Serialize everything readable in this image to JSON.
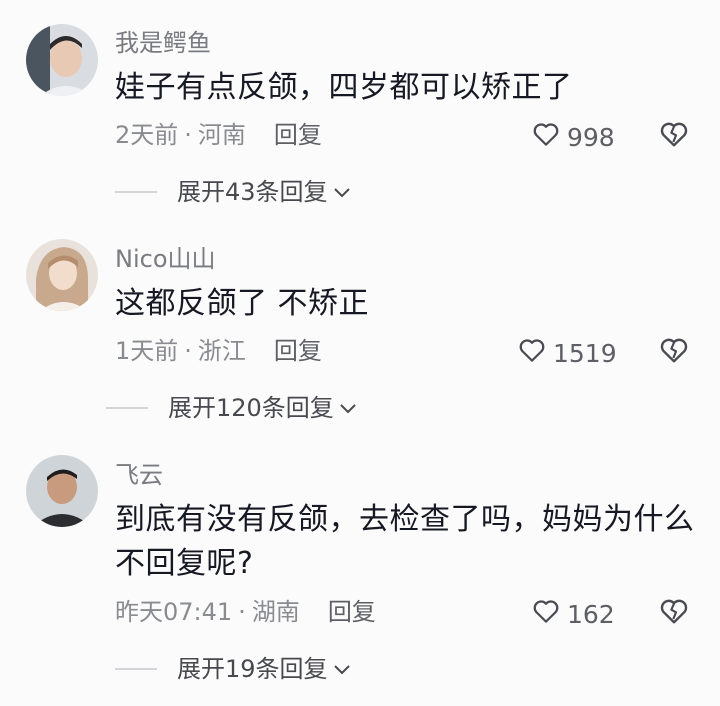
{
  "comments": [
    {
      "username": "我是鳄鱼",
      "text": "娃子有点反颌，四岁都可以矫正了",
      "time": "2天前",
      "location": "河南",
      "reply_label": "回复",
      "likes": "998",
      "expand_label": "展开43条回复"
    },
    {
      "username": "Nico山山",
      "text": "这都反颌了 不矫正",
      "time": "1天前",
      "location": "浙江",
      "reply_label": "回复",
      "likes": "1519",
      "expand_label": "展开120条回复"
    },
    {
      "username": "飞云",
      "text": "到底有没有反颌，去检查了吗，妈妈为什么不回复呢?",
      "time": "昨天07:41",
      "location": "湖南",
      "reply_label": "回复",
      "likes": "162",
      "expand_label": "展开19条回复"
    }
  ],
  "meta_separator": "·",
  "icons": {
    "like": "heart-outline-icon",
    "dislike": "broken-heart-icon",
    "expand": "chevron-down-icon"
  },
  "colors": {
    "background": "#fbfbfb",
    "text": "#161823",
    "secondary": "#8a8b90"
  }
}
